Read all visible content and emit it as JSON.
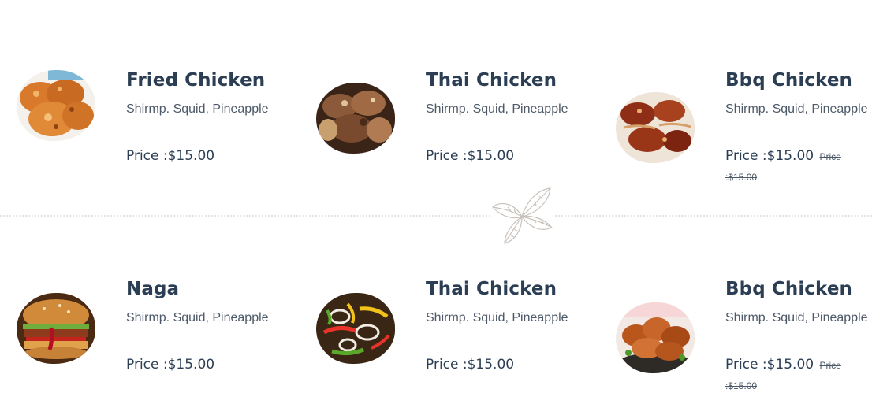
{
  "menu": {
    "items": [
      {
        "title": "Fried Chicken",
        "desc": "Shirmp. Squid, Pineapple",
        "price": "Price :$15.00",
        "old_price": "",
        "image": "fried-chicken-image"
      },
      {
        "title": "Thai Chicken",
        "desc": "Shirmp. Squid, Pineapple",
        "price": "Price :$15.00",
        "old_price": "",
        "image": "thai-chicken-image"
      },
      {
        "title": "Bbq Chicken",
        "desc": "Shirmp. Squid, Pineapple",
        "price": "Price :$15.00",
        "old_price": "Price :$15.00",
        "image": "bbq-chicken-image"
      },
      {
        "title": "Naga",
        "desc": "Shirmp. Squid, Pineapple",
        "price": "Price :$15.00",
        "old_price": "",
        "image": "burger-image"
      },
      {
        "title": "Thai Chicken",
        "desc": "Shirmp. Squid, Pineapple",
        "price": "Price :$15.00",
        "old_price": "",
        "image": "stir-fry-image"
      },
      {
        "title": "Bbq Chicken",
        "desc": "Shirmp. Squid, Pineapple",
        "price": "Price :$15.00",
        "old_price": "Price :$15.00",
        "image": "fried-wings-image"
      }
    ]
  },
  "colors": {
    "title": "#2b3e54",
    "text": "#4d5968",
    "divider": "#e5e5e5"
  },
  "decoration": {
    "icon": "leaf-icon"
  }
}
